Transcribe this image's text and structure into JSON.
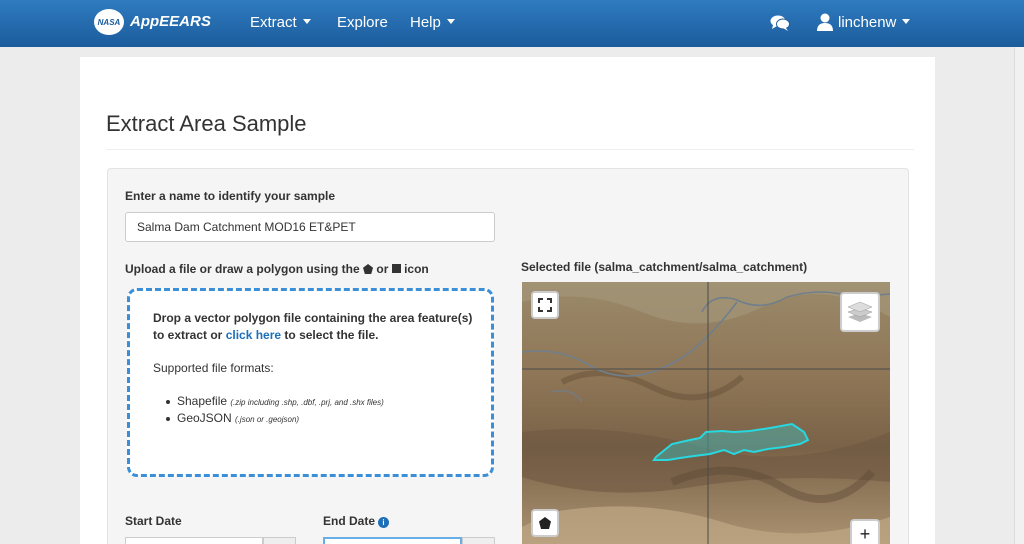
{
  "navbar": {
    "logo_text": "NASA",
    "brand": "AppEEARS",
    "items": [
      {
        "label": "Extract",
        "dropdown": true
      },
      {
        "label": "Explore",
        "dropdown": false
      },
      {
        "label": "Help",
        "dropdown": true
      }
    ],
    "chat_icon": "comments-icon",
    "user_icon": "user-icon",
    "username": "linchenw",
    "colors": {
      "bar_top": "#2f7bc0",
      "bar_bottom": "#1b5c9c"
    }
  },
  "page": {
    "title": "Extract Area Sample"
  },
  "form": {
    "name_label": "Enter a name to identify your sample",
    "name_value": "Salma Dam Catchment MOD16 ET&PET",
    "upload_label_prefix": "Upload a file or draw a polygon using the",
    "upload_label_or": "or",
    "upload_label_suffix": "icon",
    "dropzone": {
      "line_prefix": "Drop a vector polygon file containing the area feature(s) to extract or",
      "link": "click here",
      "line_suffix": "to select the file.",
      "formats_title": "Supported file formats:",
      "formats": [
        {
          "name": "Shapefile",
          "detail": "(.zip including .shp, .dbf, .prj, and .shx files)"
        },
        {
          "name": "GeoJSON",
          "detail": "(.json or .geojson)"
        }
      ],
      "border_color": "#3b8fd9"
    },
    "selected_file_label": "Selected file (salma_catchment/salma_catchment)",
    "start_date_label": "Start Date",
    "end_date_label": "End Date",
    "link_color": "#1c6fb8"
  },
  "map": {
    "controls": {
      "fullscreen": "fullscreen-icon",
      "layers": "layers-icon",
      "draw_polygon": "polygon-draw-icon",
      "zoom_in": "+"
    },
    "polygon_color": "#27d8e0"
  }
}
